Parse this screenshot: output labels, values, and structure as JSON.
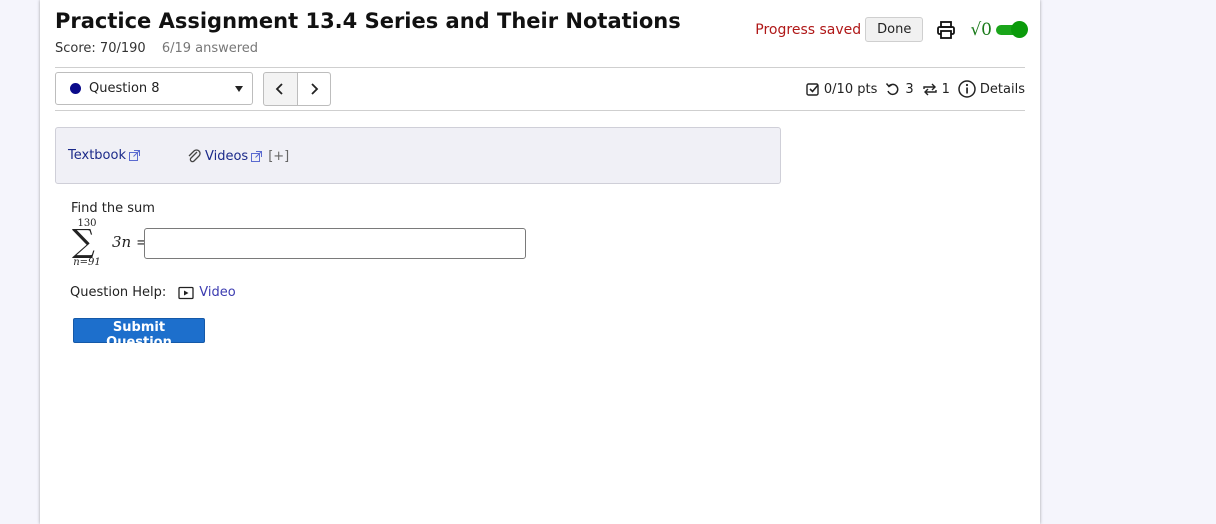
{
  "header": {
    "title": "Practice Assignment 13.4 Series and Their Notations",
    "score": "Score: 70/190",
    "answered": "6/19 answered",
    "progress_status": "Progress saved",
    "done_label": "Done",
    "math_toggle_symbol": "√0"
  },
  "question_nav": {
    "selected": "Question 8",
    "prev_symbol": "‹",
    "next_symbol": "›"
  },
  "question_stats": {
    "points": "0/10 pts",
    "attempts": "3",
    "retries": "1",
    "details_label": "Details"
  },
  "resources": {
    "textbook_label": "Textbook",
    "videos_label": "Videos",
    "expand_label": "[+]"
  },
  "question": {
    "prompt": "Find the sum",
    "upper_limit": "130",
    "lower_limit": "n=91",
    "expression": "3n =",
    "answer_value": ""
  },
  "help": {
    "label": "Question Help:",
    "video_label": "Video"
  },
  "submit_label": "Submit Question",
  "colors": {
    "progress_saved": "#b01818",
    "submit_bg": "#1d6fcc",
    "toggle_on": "#1aa51a",
    "link": "#1b2a8a"
  }
}
